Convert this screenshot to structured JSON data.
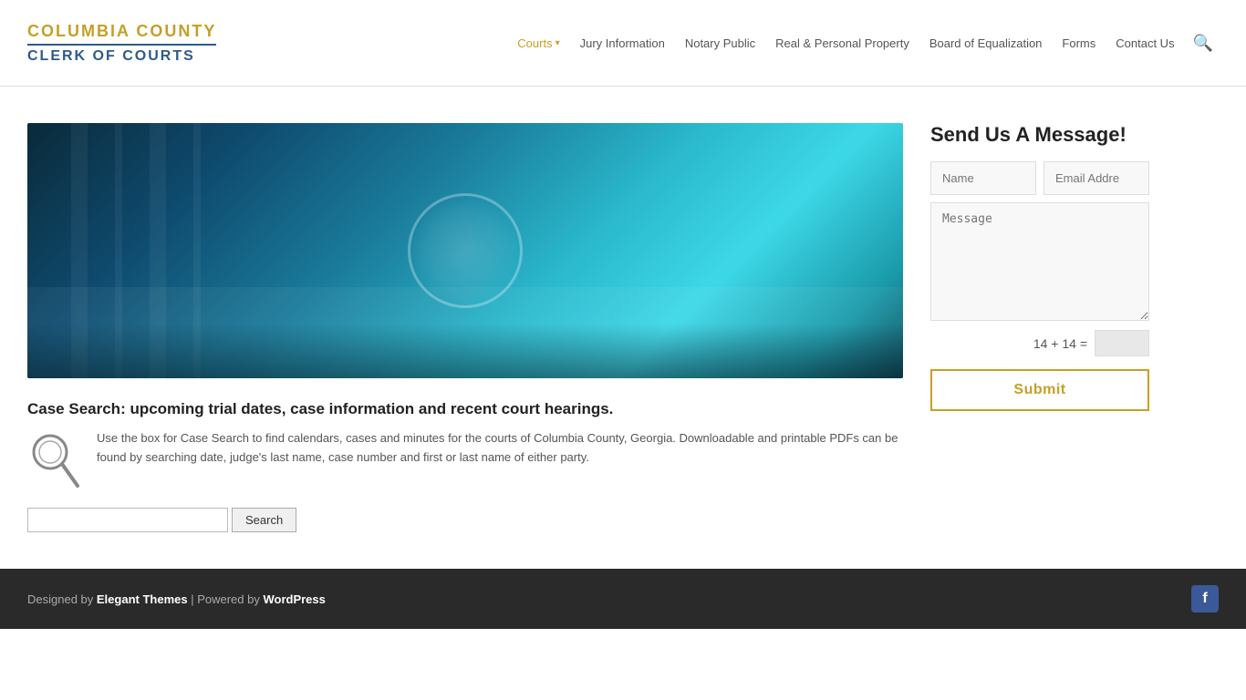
{
  "header": {
    "logo_top": "COLUMBIA COUNTY",
    "logo_bottom": "CLERK OF COURTS",
    "nav": {
      "courts_label": "Courts",
      "jury_label": "Jury Information",
      "notary_label": "Notary Public",
      "property_label": "Real & Personal Property",
      "equalization_label": "Board of Equalization",
      "forms_label": "Forms",
      "contact_label": "Contact Us"
    }
  },
  "main": {
    "case_search": {
      "title": "Case Search: upcoming trial dates, case information and recent court hearings.",
      "body": "Use the box for Case Search to find calendars, cases and minutes for the courts of Columbia County, Georgia.  Downloadable and printable PDFs can be found by searching date, judge's last name, case number and first or last name of either party.",
      "search_placeholder": "",
      "search_button_label": "Search"
    },
    "contact_form": {
      "title": "Send Us A Message!",
      "name_placeholder": "Name",
      "email_placeholder": "Email Addre",
      "message_placeholder": "Message",
      "captcha_label": "14 + 14 =",
      "submit_label": "Submit"
    }
  },
  "footer": {
    "text_before": "Designed by ",
    "elegant_themes": "Elegant Themes",
    "text_middle": " | Powered by ",
    "wordpress": "WordPress"
  }
}
